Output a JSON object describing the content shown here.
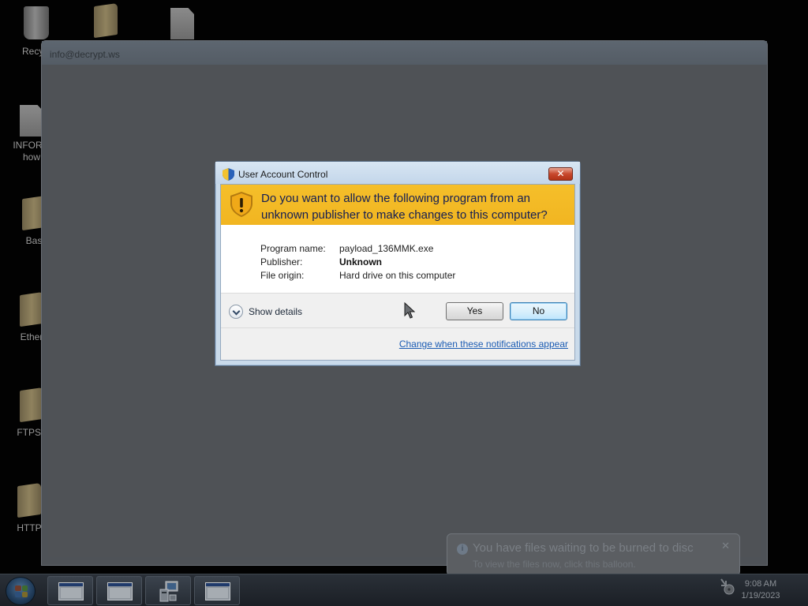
{
  "desktop": {
    "icons": [
      {
        "label": "Recycl",
        "kind": "recycle-bin"
      },
      {
        "label": "",
        "kind": "folder"
      },
      {
        "label": "",
        "kind": "document"
      },
      {
        "label": "INFORM",
        "label2": "how",
        "kind": "document"
      },
      {
        "label": "Bas",
        "kind": "folder"
      },
      {
        "label": "Ether",
        "kind": "folder"
      },
      {
        "label": "FTPSe",
        "kind": "folder"
      },
      {
        "label": "HTTP",
        "kind": "folder"
      }
    ]
  },
  "background_window": {
    "title": "info@decrypt.ws"
  },
  "uac_dialog": {
    "title": "User Account Control",
    "close_label": "✕",
    "question": "Do you want to allow the following program from an unknown publisher to make changes to this computer?",
    "fields": [
      {
        "key": "Program name:",
        "value": "payload_136MMK.exe"
      },
      {
        "key": "Publisher:",
        "value": "Unknown"
      },
      {
        "key": "File origin:",
        "value": "Hard drive on this computer"
      }
    ],
    "show_details_label": "Show details",
    "yes_label": "Yes",
    "no_label": "No",
    "notification_link": "Change when these notifications appear"
  },
  "balloon": {
    "title": "You have files waiting to be burned to disc",
    "body": "To view the files now, click this balloon.",
    "close_label": "✕",
    "info_glyph": "i"
  },
  "taskbar": {
    "time": "9:08 AM",
    "date": "1/19/2023"
  },
  "colors": {
    "warning_band": "#f5bf2a",
    "link": "#1a5bb3",
    "dialog_frame": "#c9daea"
  }
}
